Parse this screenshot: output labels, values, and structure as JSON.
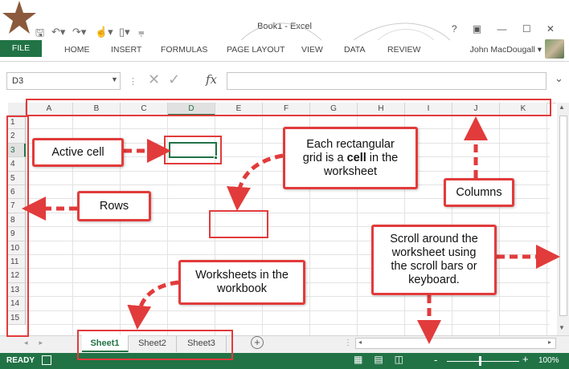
{
  "window": {
    "title": "Book1 - Excel",
    "controls": "? ▣ — ☐ ✕"
  },
  "ribbon": {
    "tabs": [
      "FILE",
      "HOME",
      "INSERT",
      "FORMULAS",
      "PAGE LAYOUT",
      "VIEW",
      "DATA",
      "REVIEW"
    ],
    "user": "John MacDougall ▾"
  },
  "formula_bar": {
    "name_box": "D3",
    "fx": "fx",
    "value": ""
  },
  "grid": {
    "columns": [
      "A",
      "B",
      "C",
      "D",
      "E",
      "F",
      "G",
      "H",
      "I",
      "J",
      "K"
    ],
    "rows": [
      "1",
      "2",
      "3",
      "4",
      "5",
      "6",
      "7",
      "8",
      "9",
      "10",
      "11",
      "12",
      "13",
      "14",
      "15"
    ],
    "selected_column": "D",
    "selected_row": "3"
  },
  "sheets": {
    "tabs": [
      "Sheet1",
      "Sheet2",
      "Sheet3"
    ],
    "active": "Sheet1",
    "add": "+"
  },
  "status": {
    "text": "READY",
    "zoom_minus": "-",
    "zoom_plus": "+",
    "zoom": "100%"
  },
  "annotations": {
    "active_cell": "Active cell",
    "cell_line1": "Each rectangular",
    "cell_line2a": "grid is a ",
    "cell_line2b": "cell",
    "cell_line2c": " in the",
    "cell_line3": "worksheet",
    "rows": "Rows",
    "columns": "Columns",
    "scroll_line1": "Scroll around the",
    "scroll_line2": "worksheet using",
    "scroll_line3": "the scroll bars or",
    "scroll_line4": "keyboard.",
    "worksheets_line1": "Worksheets in the",
    "worksheets_line2": "workbook"
  },
  "colors": {
    "excel_green": "#217346",
    "annotation_red": "#e23b3b",
    "logo_star": "#8b5a3c"
  }
}
